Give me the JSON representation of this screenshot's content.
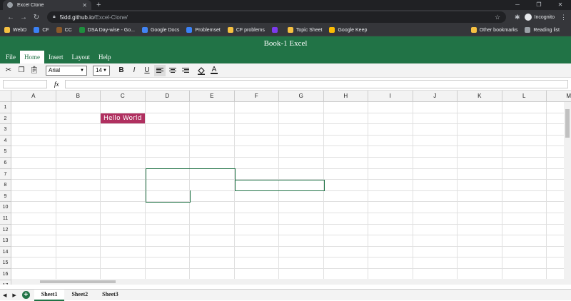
{
  "browser": {
    "tab_title": "Excel Clone",
    "url_host": "5idd.github.io",
    "url_path": "/Excel-Clone/",
    "profile_label": "Incognito",
    "bookmarks": [
      {
        "label": "WebD",
        "color": "#f6c142"
      },
      {
        "label": "CF",
        "color": "#3b82f6"
      },
      {
        "label": "CC",
        "color": "#8b5a2b"
      },
      {
        "label": "DSA Day-wise - Go...",
        "color": "#1e8e3e"
      },
      {
        "label": "Google Docs",
        "color": "#4285f4"
      },
      {
        "label": "Problemset",
        "color": "#3b82f6"
      },
      {
        "label": "CF problems",
        "color": "#f6c142"
      },
      {
        "label": "",
        "color": "#7c3aed"
      },
      {
        "label": "Topic Sheet",
        "color": "#f6c142"
      },
      {
        "label": "Google Keep",
        "color": "#fbbc04"
      }
    ],
    "bookmarks_right": [
      {
        "label": "Other bookmarks",
        "color": "#f6c142"
      },
      {
        "label": "Reading list",
        "color": "#9aa0a6"
      }
    ]
  },
  "app": {
    "title": "Book-1 Excel",
    "menus": [
      {
        "label": "File",
        "active": false
      },
      {
        "label": "Home",
        "active": true
      },
      {
        "label": "Insert",
        "active": false
      },
      {
        "label": "Layout",
        "active": false
      },
      {
        "label": "Help",
        "active": false
      }
    ],
    "toolbar": {
      "font_family": "Arial",
      "font_size": "14",
      "bold": "B",
      "italic": "I",
      "underline": "U",
      "text_color": "A"
    },
    "formula": {
      "fx_label": "fx",
      "address": "",
      "value": ""
    },
    "accent_color": "#217346"
  },
  "grid": {
    "columns": [
      "A",
      "B",
      "C",
      "D",
      "E",
      "F",
      "G",
      "H",
      "I",
      "J",
      "K",
      "L",
      "M"
    ],
    "rows": [
      "1",
      "2",
      "3",
      "4",
      "5",
      "6",
      "7",
      "8",
      "9",
      "10",
      "11",
      "12",
      "13",
      "14",
      "15",
      "16",
      "17"
    ],
    "cells": [
      {
        "address": "C2",
        "value": "Hello World",
        "background": "#b03060",
        "color": "#ffffff"
      }
    ]
  },
  "sheets": [
    {
      "label": "Sheet1",
      "active": true
    },
    {
      "label": "Sheet2",
      "active": false
    },
    {
      "label": "Sheet3",
      "active": false
    }
  ]
}
